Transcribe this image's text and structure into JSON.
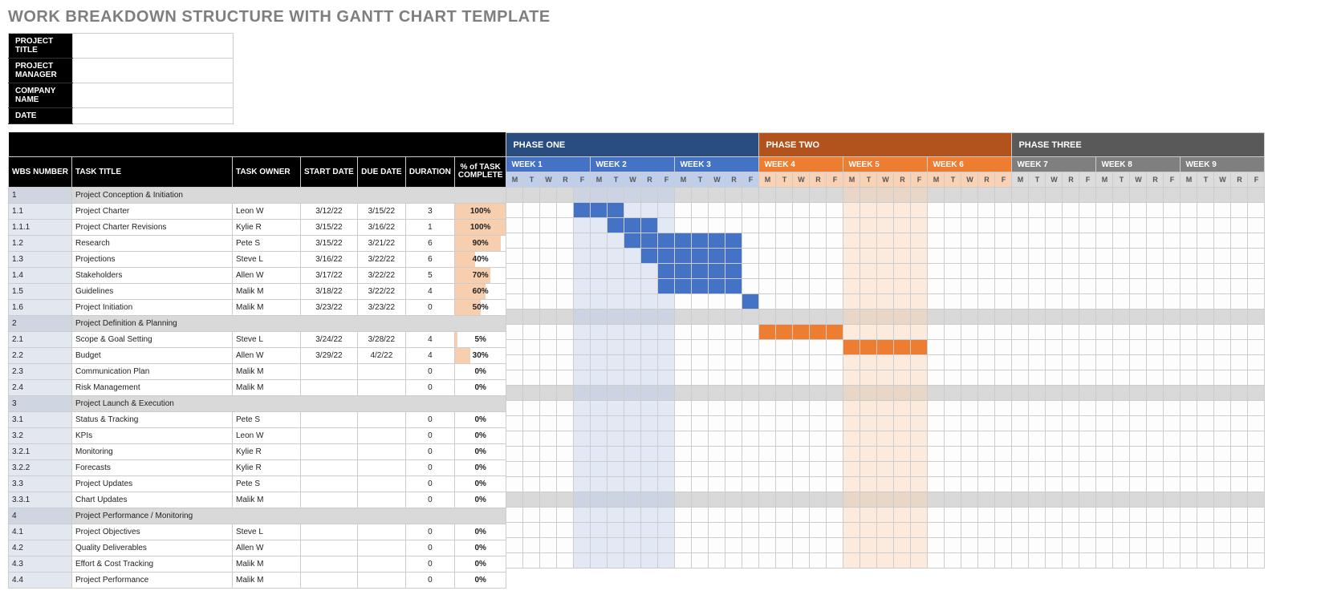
{
  "title": "WORK BREAKDOWN STRUCTURE WITH GANTT CHART TEMPLATE",
  "meta_labels": [
    "PROJECT TITLE",
    "PROJECT MANAGER",
    "COMPANY NAME",
    "DATE"
  ],
  "columns": [
    "WBS NUMBER",
    "TASK TITLE",
    "TASK OWNER",
    "START DATE",
    "DUE DATE",
    "DURATION",
    "% of TASK COMPLETE"
  ],
  "phases": [
    {
      "label": "PHASE ONE",
      "weeks": [
        "WEEK 1",
        "WEEK 2",
        "WEEK 3"
      ],
      "cls": "p1",
      "wcls": "w1",
      "zone": "z1"
    },
    {
      "label": "PHASE TWO",
      "weeks": [
        "WEEK 4",
        "WEEK 5",
        "WEEK 6"
      ],
      "cls": "p2",
      "wcls": "w2",
      "zone": "z2"
    },
    {
      "label": "PHASE THREE",
      "weeks": [
        "WEEK 7",
        "WEEK 8",
        "WEEK 9"
      ],
      "cls": "p3",
      "wcls": "w3",
      "zone": "z3"
    }
  ],
  "days": [
    "M",
    "T",
    "W",
    "R",
    "F"
  ],
  "band_cols_z1": [
    4,
    5,
    6,
    7,
    8,
    9
  ],
  "band_cols_z2": [
    20,
    21,
    22,
    23,
    24
  ],
  "chart_data": {
    "type": "gantt",
    "unit": "workday-index (0 = Week1 Mon)",
    "rows": [
      {
        "wbs": "1",
        "title": "Project Conception & Initiation",
        "section": true
      },
      {
        "wbs": "1.1",
        "title": "Project Charter",
        "owner": "Leon W",
        "start": "3/12/22",
        "due": "3/15/22",
        "dur": "3",
        "pct": 100,
        "bar": [
          4,
          6
        ],
        "color": 1
      },
      {
        "wbs": "1.1.1",
        "title": "Project Charter Revisions",
        "owner": "Kylie R",
        "start": "3/15/22",
        "due": "3/16/22",
        "dur": "1",
        "pct": 100,
        "bar": [
          6,
          8
        ],
        "color": 1
      },
      {
        "wbs": "1.2",
        "title": "Research",
        "owner": "Pete S",
        "start": "3/15/22",
        "due": "3/21/22",
        "dur": "6",
        "pct": 90,
        "bar": [
          7,
          13
        ],
        "color": 1
      },
      {
        "wbs": "1.3",
        "title": "Projections",
        "owner": "Steve L",
        "start": "3/16/22",
        "due": "3/22/22",
        "dur": "6",
        "pct": 40,
        "bar": [
          8,
          13
        ],
        "color": 1
      },
      {
        "wbs": "1.4",
        "title": "Stakeholders",
        "owner": "Allen W",
        "start": "3/17/22",
        "due": "3/22/22",
        "dur": "5",
        "pct": 70,
        "bar": [
          9,
          13
        ],
        "color": 1
      },
      {
        "wbs": "1.5",
        "title": "Guidelines",
        "owner": "Malik M",
        "start": "3/18/22",
        "due": "3/22/22",
        "dur": "4",
        "pct": 60,
        "bar": [
          9,
          13
        ],
        "color": 1
      },
      {
        "wbs": "1.6",
        "title": "Project Initiation",
        "owner": "Malik M",
        "start": "3/23/22",
        "due": "3/23/22",
        "dur": "0",
        "pct": 50,
        "bar": [
          14,
          14
        ],
        "color": 1
      },
      {
        "wbs": "2",
        "title": "Project Definition & Planning",
        "section": true
      },
      {
        "wbs": "2.1",
        "title": "Scope & Goal Setting",
        "owner": "Steve L",
        "start": "3/24/22",
        "due": "3/28/22",
        "dur": "4",
        "pct": 5,
        "bar": [
          15,
          19
        ],
        "color": 2
      },
      {
        "wbs": "2.2",
        "title": "Budget",
        "owner": "Allen W",
        "start": "3/29/22",
        "due": "4/2/22",
        "dur": "4",
        "pct": 30,
        "bar": [
          20,
          24
        ],
        "color": 2
      },
      {
        "wbs": "2.3",
        "title": "Communication Plan",
        "owner": "Malik M",
        "start": "",
        "due": "",
        "dur": "0",
        "pct": 0
      },
      {
        "wbs": "2.4",
        "title": "Risk Management",
        "owner": "Malik M",
        "start": "",
        "due": "",
        "dur": "0",
        "pct": 0
      },
      {
        "wbs": "3",
        "title": "Project Launch & Execution",
        "section": true
      },
      {
        "wbs": "3.1",
        "title": "Status & Tracking",
        "owner": "Pete S",
        "start": "",
        "due": "",
        "dur": "0",
        "pct": 0
      },
      {
        "wbs": "3.2",
        "title": "KPIs",
        "owner": "Leon W",
        "start": "",
        "due": "",
        "dur": "0",
        "pct": 0
      },
      {
        "wbs": "3.2.1",
        "title": "Monitoring",
        "owner": "Kylie R",
        "start": "",
        "due": "",
        "dur": "0",
        "pct": 0
      },
      {
        "wbs": "3.2.2",
        "title": "Forecasts",
        "owner": "Kylie R",
        "start": "",
        "due": "",
        "dur": "0",
        "pct": 0
      },
      {
        "wbs": "3.3",
        "title": "Project Updates",
        "owner": "Pete S",
        "start": "",
        "due": "",
        "dur": "0",
        "pct": 0
      },
      {
        "wbs": "3.3.1",
        "title": "Chart Updates",
        "owner": "Malik M",
        "start": "",
        "due": "",
        "dur": "0",
        "pct": 0
      },
      {
        "wbs": "4",
        "title": "Project Performance / Monitoring",
        "section": true
      },
      {
        "wbs": "4.1",
        "title": "Project Objectives",
        "owner": "Steve L",
        "start": "",
        "due": "",
        "dur": "0",
        "pct": 0
      },
      {
        "wbs": "4.2",
        "title": "Quality Deliverables",
        "owner": "Allen W",
        "start": "",
        "due": "",
        "dur": "0",
        "pct": 0
      },
      {
        "wbs": "4.3",
        "title": "Effort & Cost Tracking",
        "owner": "Malik M",
        "start": "",
        "due": "",
        "dur": "0",
        "pct": 0
      },
      {
        "wbs": "4.4",
        "title": "Project Performance",
        "owner": "Malik M",
        "start": "",
        "due": "",
        "dur": "0",
        "pct": 0
      }
    ]
  }
}
